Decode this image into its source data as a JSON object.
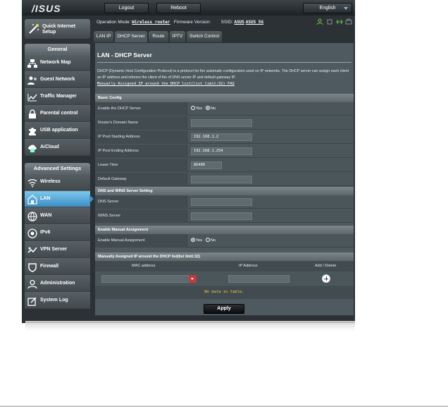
{
  "header": {
    "logo": "/ISUS",
    "logout": "Logout",
    "reboot": "Reboot",
    "language": "English"
  },
  "info": {
    "operation_mode_label": "Operation Mode:",
    "operation_mode_value": "Wireless router",
    "firmware_label": "Firmware Version:",
    "ssid_label": "SSID:",
    "ssid_1": "ASUS",
    "ssid_2": "ASUS_5G"
  },
  "sidebar": {
    "quick_setup": "Quick Internet Setup",
    "general_title": "General",
    "general_items": [
      {
        "label": "Network Map",
        "icon": "network-map-icon"
      },
      {
        "label": "Guest Network",
        "icon": "guest-network-icon"
      },
      {
        "label": "Traffic Manager",
        "icon": "traffic-manager-icon"
      },
      {
        "label": "Parental control",
        "icon": "lock-icon"
      },
      {
        "label": "USB application",
        "icon": "puzzle-icon"
      },
      {
        "label": "AiCloud",
        "icon": "cloud-house-icon"
      }
    ],
    "advanced_title": "Advanced Settings",
    "advanced_items": [
      {
        "label": "Wireless",
        "icon": "wifi-icon"
      },
      {
        "label": "LAN",
        "icon": "lan-icon",
        "active": true
      },
      {
        "label": "WAN",
        "icon": "globe-icon"
      },
      {
        "label": "IPv6",
        "icon": "ipv6-icon"
      },
      {
        "label": "VPN Server",
        "icon": "vpn-icon"
      },
      {
        "label": "Firewall",
        "icon": "shield-icon"
      },
      {
        "label": "Administration",
        "icon": "admin-icon"
      },
      {
        "label": "System Log",
        "icon": "log-icon"
      }
    ]
  },
  "tabs": [
    "LAN IP",
    "DHCP Server",
    "Route",
    "IPTV",
    "Switch Control"
  ],
  "page": {
    "title": "LAN - DHCP Server",
    "description": "DHCP (Dynamic Host Configuration Protocol) is a protocol for the automatic configuration used on IP networks. The DHCP server can assign each client an IP address and informs the client of the of DNS server IP and default gateway IP.",
    "faq_link": "Manually Assigned IP around the DHCP list(list limit:32) FAQ"
  },
  "basic_config": {
    "title": "Basic Config",
    "enable_dhcp_label": "Enable the DHCP Server",
    "yes": "Yes",
    "no": "No",
    "domain_name_label": "Router's Domain Name",
    "domain_name_value": "",
    "pool_start_label": "IP Pool Starting Address",
    "pool_start_value": "192.168.1.2",
    "pool_end_label": "IP Pool Ending Address",
    "pool_end_value": "192.168.1.254",
    "lease_label": "Lease Time",
    "lease_value": "86400",
    "gateway_label": "Default Gateway",
    "gateway_value": ""
  },
  "dns_wins": {
    "title": "DNS and WINS Server Setting",
    "dns_label": "DNS Server",
    "dns_value": "",
    "wins_label": "WINS Server",
    "wins_value": ""
  },
  "manual": {
    "title": "Enable Manual Assignment",
    "enable_label": "Enable Manual Assignment",
    "yes": "Yes",
    "no": "No"
  },
  "manual_list": {
    "title": "Manually Assigned IP around the DHCP list(list limit:32)",
    "col_mac": "MAC address",
    "col_ip": "IP Address",
    "col_add": "Add / Delete",
    "no_data": "No data in table."
  },
  "apply": "Apply",
  "colors": {
    "active_menu": "#3d8fc4",
    "no_data_text": "#f2cc3a",
    "panel_bg": "#4e5a5f"
  }
}
